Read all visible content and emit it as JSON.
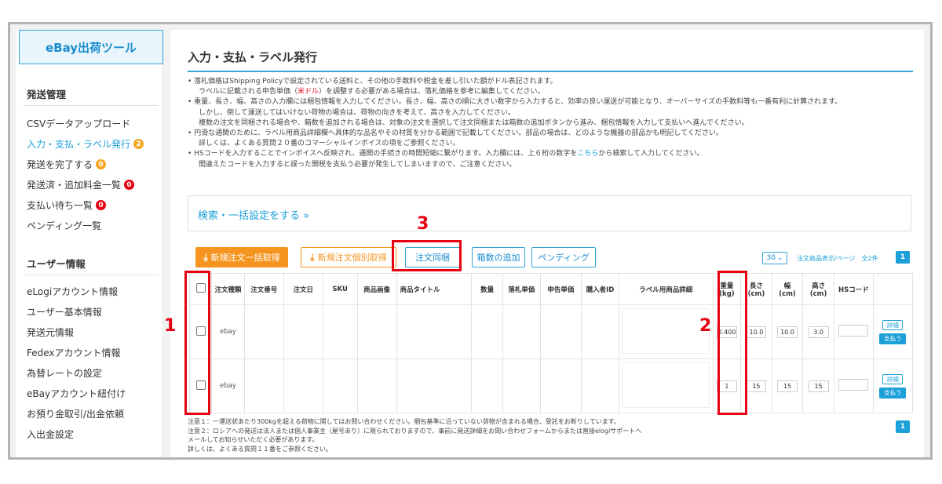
{
  "sidebar": {
    "brand": "eBay出荷ツール",
    "section1": "発送管理",
    "items1": [
      {
        "label": "CSVデータアップロード",
        "badge": ""
      },
      {
        "label": "入力・支払・ラベル発行",
        "badge": "2"
      },
      {
        "label": "発送を完了する",
        "badge": "0"
      },
      {
        "label": "発送済・追加料金一覧",
        "badge": "0"
      },
      {
        "label": "支払い待ち一覧",
        "badge": "0"
      },
      {
        "label": "ペンディング一覧",
        "badge": ""
      }
    ],
    "section2": "ユーザー情報",
    "items2": [
      {
        "label": "eLogiアカウント情報"
      },
      {
        "label": "ユーザー基本情報"
      },
      {
        "label": "発送元情報"
      },
      {
        "label": "Fedexアカウント情報"
      },
      {
        "label": "為替レートの設定"
      },
      {
        "label": "eBayアカウント紐付け"
      },
      {
        "label": "お預り金取引/出金依頼"
      },
      {
        "label": "入出金設定"
      }
    ]
  },
  "main": {
    "title": "入力・支払・ラベル発行",
    "notes": {
      "l1": "• 落札価格はShipping Policyで設定されている送料と、その他の手数料や税金を差し引いた額がドル表記されます。",
      "l2a": "ラベルに記載される申告単価（",
      "l2red": "米ドル",
      "l2b": "）を調整する必要がある場合は、落札価格を参考に編集してください。",
      "l3": "• 重量、長さ、幅、高さの入力欄には梱包情報を入力してください。長さ、幅、高さの順に大きい数字から入力すると、効率の良い運送が可能となり、オーバーサイズの手数料等も一番有利に計算されます。",
      "l4": "しかし、倒して運送してはいけない荷物の場合は、荷物の向きを考えて、高さを入力してください。",
      "l5": "複数の注文を同梱される場合や、箱数を追加される場合は、対象の注文を選択して注文同梱または箱数の追加ボタンから進み、梱包情報を入力して支払いへ進んでください。",
      "l6": "• 円滑な通関のために、ラベル用商品詳細欄へ具体的な品名やその材質を分かる範囲で記載してください。部品の場合は、どのような機器の部品かも明記してください。",
      "l7": "詳しくは、よくある質問２０番のコマーシャルインボイスの項をご参照ください。",
      "l8a": "• HSコードを入力することでインボイスへ反映され、通関の手続きの時間短縮に繋がります。入力欄には、上６桁の数字を",
      "l8link": "こちら",
      "l8b": "から検索して入力してください。",
      "l9": "間違えたコードを入力すると誤った関税を支払う必要が発生してしまいますので、ご注意ください。"
    },
    "search_link": "検索・一括設定をする »",
    "buttons": {
      "bulk_fetch": "新規注文一括取得",
      "single_fetch": "新規注文個別取得",
      "combine": "注文同梱",
      "add_boxes": "箱数の追加",
      "pending": "ペンディング"
    },
    "per_page": "30",
    "per_page_text": "注文商品表示/ページ　全2件",
    "page": "1",
    "table": {
      "headers": [
        "",
        "注文種類",
        "注文番号",
        "注文日",
        "SKU",
        "商品画像",
        "商品タイトル",
        "数量",
        "落札単価",
        "申告単価",
        "購入者ID",
        "ラベル用商品詳細",
        "重量\n(kg)",
        "長さ\n(cm)",
        "幅\n(cm)",
        "高さ\n(cm)",
        "HSコード",
        ""
      ],
      "rows": [
        {
          "type": "ebay",
          "weight": "0.400",
          "length": "10.0",
          "width": "10.0",
          "height": "3.0",
          "detail": "詳細",
          "pay": "支払う"
        },
        {
          "type": "ebay",
          "weight": "1",
          "length": "15",
          "width": "15",
          "height": "15",
          "detail": "詳細",
          "pay": "支払う"
        }
      ]
    },
    "footer": {
      "l1": "注意１：一運送状あたり300kgを超える荷物に関してはお問い合わせください。梱包基準に沿っていない貨物が含まれる場合、受託をお断りしています。",
      "l2": "注意２：ロシアへの発送は法人または個人事業主（屋号あり）に限られておりますので、事前に発送詳細をお問い合わせフォームからまたは直接elogiサポートへ",
      "l3": "メールしてお知らせいただく必要があります。",
      "l4": "詳しくは、よくある質問１１番をご参照ください。"
    }
  },
  "annotations": {
    "a1": "1",
    "a2": "2",
    "a3": "3"
  },
  "colors": {
    "accent": "#1ca0d8",
    "orange": "#f5941f",
    "highlight": "#e60012"
  }
}
